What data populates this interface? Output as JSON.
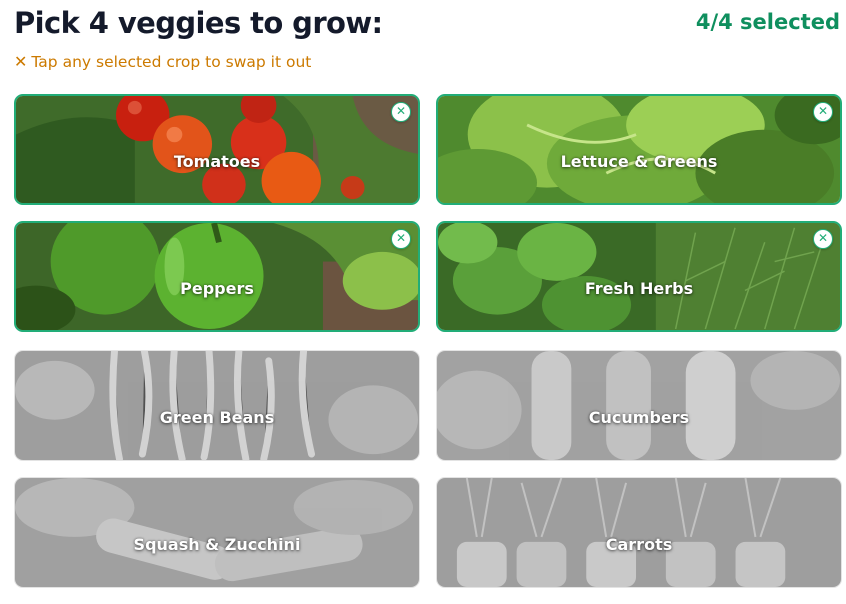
{
  "header": {
    "title": "Pick 4 veggies to grow:",
    "count": "4/4 selected",
    "hint_icon": "close-icon",
    "hint": "Tap any selected crop to swap it out"
  },
  "cards": [
    {
      "label": "Tomatoes",
      "selected": true
    },
    {
      "label": "Lettuce & Greens",
      "selected": true
    },
    {
      "label": "Peppers",
      "selected": true
    },
    {
      "label": "Fresh Herbs",
      "selected": true
    },
    {
      "label": "Green Beans",
      "selected": false
    },
    {
      "label": "Cucumbers",
      "selected": false
    },
    {
      "label": "Squash & Zucchini",
      "selected": false
    },
    {
      "label": "Carrots",
      "selected": false
    }
  ],
  "remove_icon": "✕",
  "colors": {
    "accent": "#22ad78",
    "count": "#0f8f5e",
    "hint": "#cc7a00",
    "title": "#141a2b"
  }
}
